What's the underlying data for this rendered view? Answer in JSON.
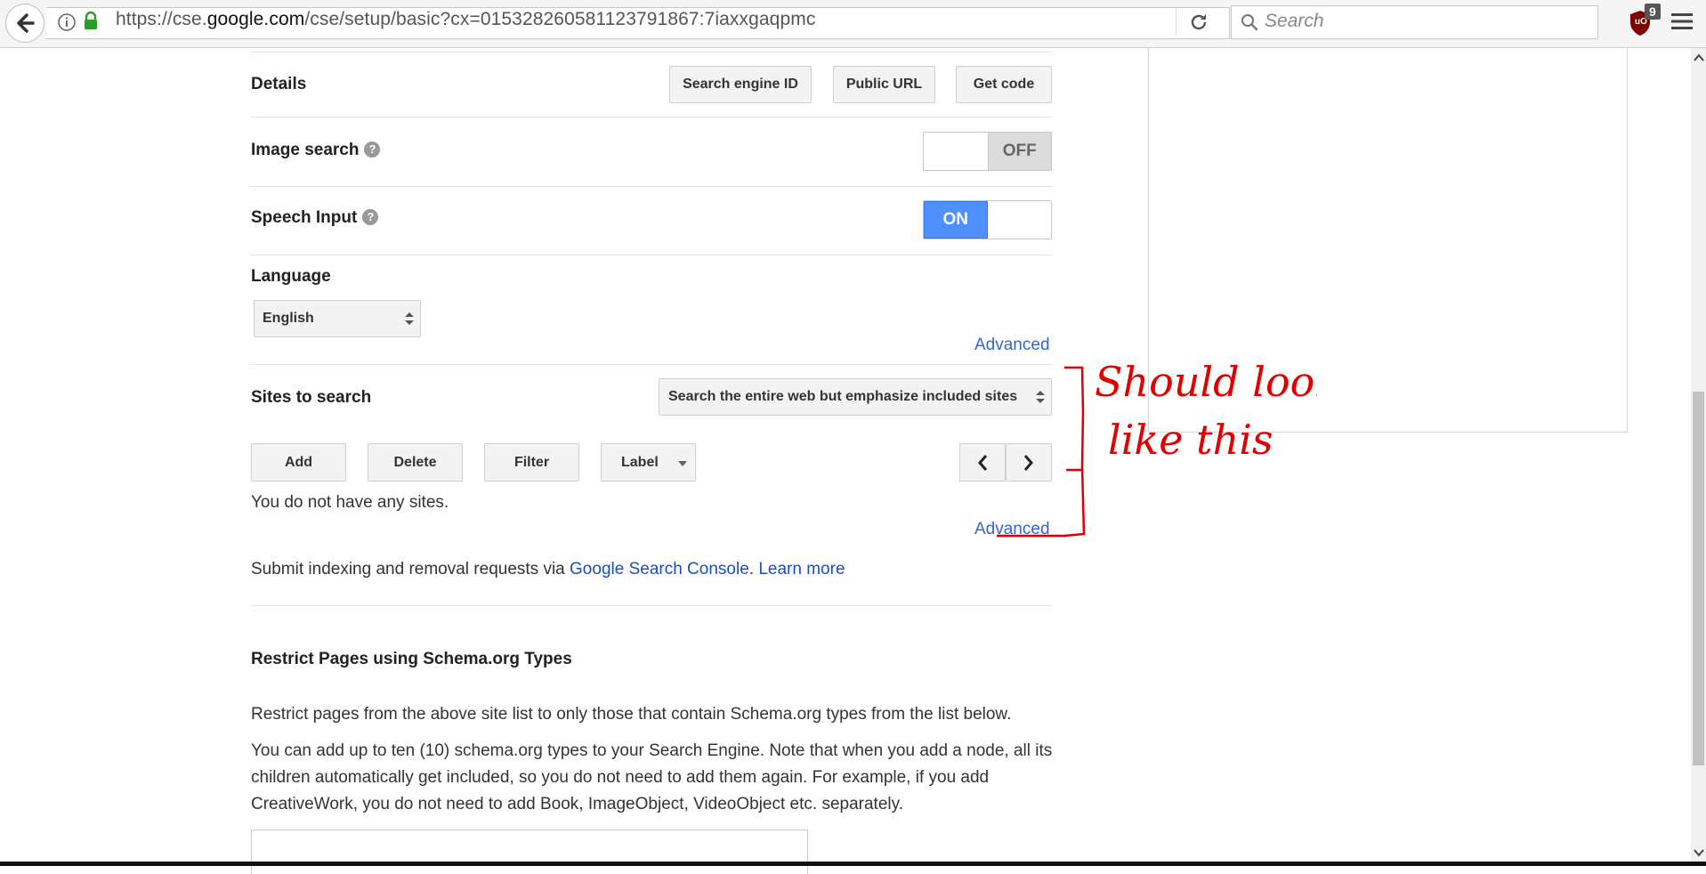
{
  "browser": {
    "url_prefix": "https://cse.",
    "url_host": "google.com",
    "url_path": "/cse/setup/basic?cx=015328260581123791867:7iaxxgaqpmc",
    "search_placeholder": "Search",
    "extension_badge_count": "9",
    "extension_label": "uO"
  },
  "details": {
    "label": "Details",
    "buttons": [
      "Search engine ID",
      "Public URL",
      "Get code"
    ]
  },
  "image_search": {
    "label": "Image search",
    "help": "?",
    "state": "OFF"
  },
  "speech_input": {
    "label": "Speech Input",
    "help": "?",
    "state": "ON"
  },
  "language": {
    "label": "Language",
    "selected": "English",
    "advanced_link": "Advanced"
  },
  "sites": {
    "label": "Sites to search",
    "mode_selected": "Search the entire web but emphasize included sites",
    "toolbar": [
      "Add",
      "Delete",
      "Filter",
      "Label"
    ],
    "empty_message": "You do not have any sites.",
    "advanced_link": "Advanced",
    "submit_text": "Submit indexing and removal requests via ",
    "console_link": "Google Search Console",
    "learn_more": "Learn more"
  },
  "schema": {
    "title": "Restrict Pages using Schema.org Types",
    "para1": "Restrict pages from the above site list to only those that contain Schema.org types from the list below.",
    "para2": "You can add up to ten (10) schema.org types to your Search Engine. Note that when you add a node, all its children automatically get included, so you do not need to add them again. For example, if you add CreativeWork, you do not need to add Book, ImageObject, VideoObject etc. separately."
  },
  "annotation": {
    "text_line1": "Should look",
    "text_line2": "like this",
    "color": "#e00000"
  },
  "colors": {
    "accent": "#4d90fe",
    "link": "#3366cc"
  }
}
